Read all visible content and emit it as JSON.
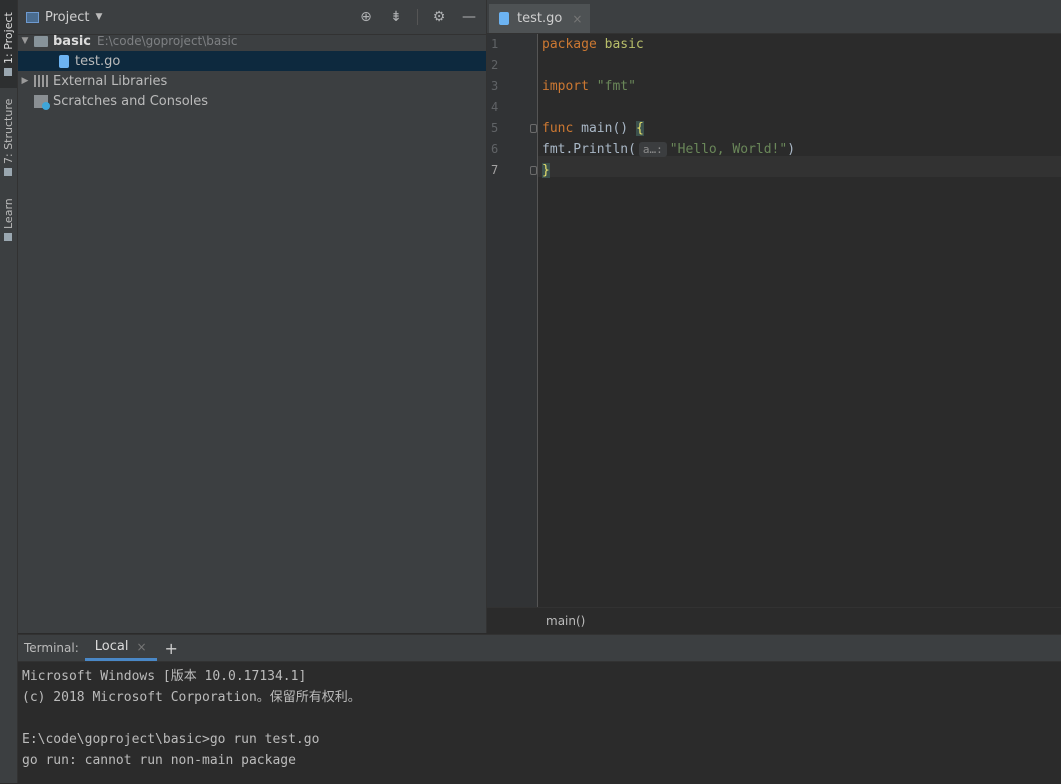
{
  "side_tabs": [
    {
      "label": "1: Project"
    },
    {
      "label": "7: Structure"
    },
    {
      "label": "Learn"
    }
  ],
  "project": {
    "title": "Project",
    "tree": {
      "root_name": "basic",
      "root_path": "E:\\code\\goproject\\basic",
      "file": "test.go",
      "external": "External Libraries",
      "scratches": "Scratches and Consoles"
    }
  },
  "editor": {
    "tab_label": "test.go",
    "close": "×",
    "line_numbers": [
      "1",
      "2",
      "3",
      "4",
      "5",
      "6",
      "7"
    ],
    "code": {
      "kw_package": "package",
      "pkg_name": "basic",
      "kw_import": "import",
      "import_path": "\"fmt\"",
      "kw_func": "func",
      "func_sig": "main()",
      "open_brace": "{",
      "call": "fmt.Println(",
      "hint": "a…:",
      "arg": "\"Hello, World!\"",
      "close_paren": ")",
      "close_brace": "}"
    },
    "breadcrumb": "main()"
  },
  "terminal": {
    "label": "Terminal:",
    "tab": "Local",
    "close": "×",
    "add": "+",
    "lines": [
      "Microsoft Windows [版本 10.0.17134.1]",
      "(c) 2018 Microsoft Corporation。保留所有权利。",
      "",
      "E:\\code\\goproject\\basic>go run test.go",
      "go run: cannot run non-main package"
    ]
  }
}
